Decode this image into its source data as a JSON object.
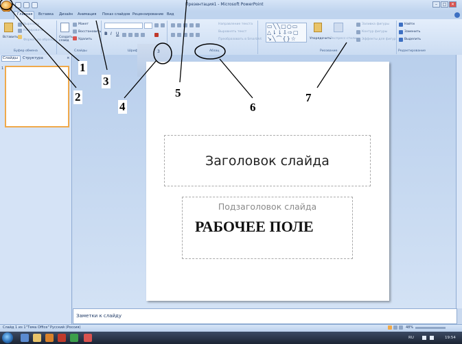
{
  "window": {
    "title": "Презентация1 - Microsoft PowerPoint",
    "minimize": "–",
    "maximize": "□",
    "close": "✕"
  },
  "tabs": [
    "Главная",
    "Вставка",
    "Дизайн",
    "Анимация",
    "Показ слайдов",
    "Рецензирование",
    "Вид"
  ],
  "ribbon": {
    "clipboard": {
      "paste": "Вставить",
      "cut": "Вырезать",
      "copy": "Копировать",
      "format_painter": "Формат по образцу",
      "label": "Буфер обмена"
    },
    "slides": {
      "new_slide": "Создать слайд",
      "layout": "Макет",
      "reset": "Восстановить",
      "delete": "Удалить",
      "label": "Слайды"
    },
    "font": {
      "label": "Шрифт"
    },
    "paragraph": {
      "text_direction": "Направление текста",
      "align_text": "Выровнять текст",
      "smartart": "Преобразовать в SmartArt",
      "label": "Абзац"
    },
    "drawing": {
      "arrange": "Упорядочить",
      "quick_styles": "Экспресс-стили",
      "shape_fill": "Заливка фигуры",
      "shape_outline": "Контур фигуры",
      "shape_effects": "Эффекты для фигур",
      "label": "Рисование"
    },
    "editing": {
      "find": "Найти",
      "replace": "Заменить",
      "select": "Выделить",
      "label": "Редактирование"
    }
  },
  "left_panel": {
    "tab_slides": "Слайды",
    "tab_outline": "Структура",
    "close": "×",
    "slide_number": "1"
  },
  "slide": {
    "title_placeholder": "Заголовок слайда",
    "subtitle_placeholder": "Подзаголовок слайда",
    "work_area_label": "РАБОЧЕЕ ПОЛЕ"
  },
  "notes": {
    "placeholder": "Заметки к слайду"
  },
  "status_bar": {
    "slide_counter": "Слайд 1 из 1",
    "theme": "\"Тема Office\"",
    "language": "Русский (Россия)",
    "zoom": "48%"
  },
  "taskbar": {
    "language": "RU",
    "time": "19:54"
  },
  "annotations": [
    "1",
    "2",
    "3",
    "4",
    "5",
    "6",
    "7"
  ],
  "popup_digit": "3",
  "colors": {
    "ribbon_bg": "#dbe7f8",
    "office_button": "#e8952a",
    "selection_border": "#f0a94a",
    "taskbar": "#1c2433"
  }
}
